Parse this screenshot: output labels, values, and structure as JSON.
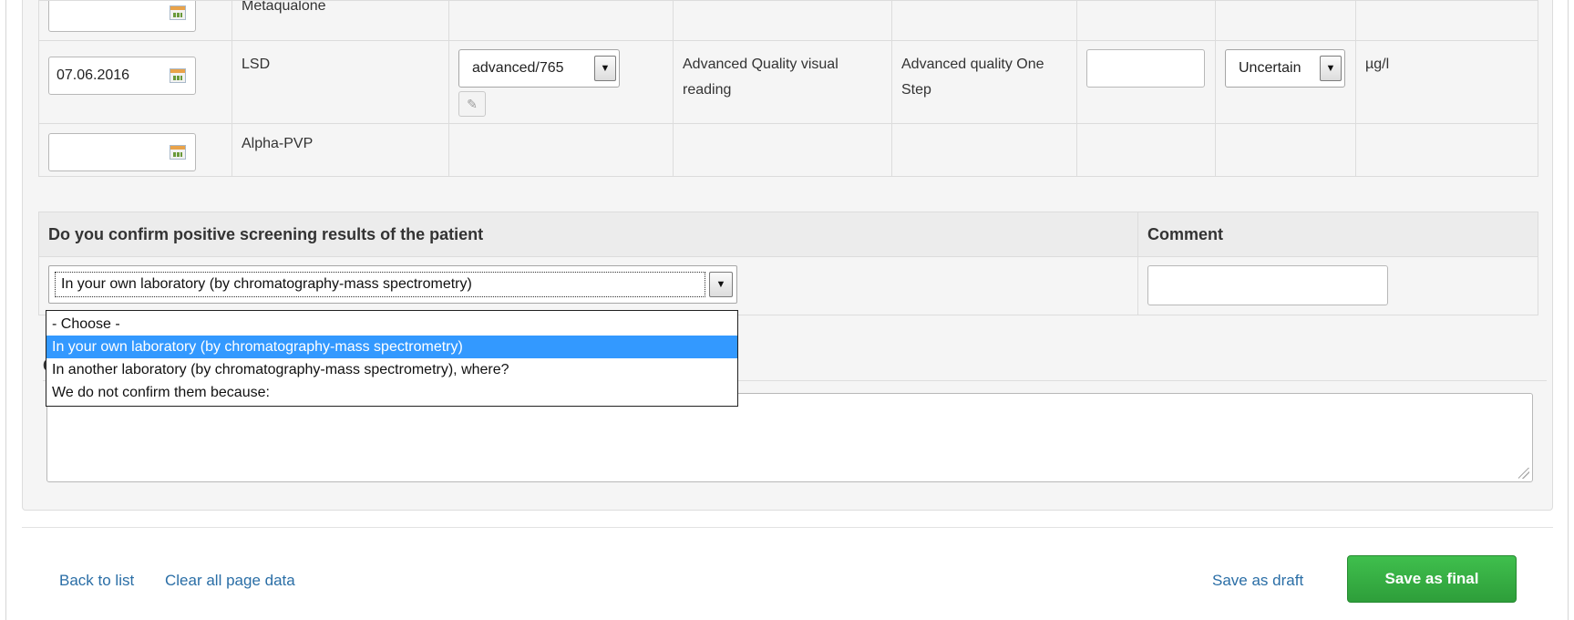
{
  "substances": {
    "rows": [
      {
        "date": "",
        "name": "Metaqualone"
      },
      {
        "date": "07.06.2016",
        "name": "LSD",
        "kit": "advanced/765",
        "method": "Advanced Quality visual reading",
        "analyzer": "Advanced quality One Step",
        "result": "",
        "interpretation": "Uncertain",
        "unit": "µg/l"
      },
      {
        "date": "",
        "name": "Alpha-PVP"
      }
    ]
  },
  "confirmation": {
    "question_header": "Do you confirm positive screening results of the patient",
    "comment_header": "Comment",
    "selected_value": "In your own laboratory (by chromatography-mass spectrometry)",
    "comment_value": "",
    "options": [
      "- Choose -",
      "In your own laboratory (by chromatography-mass spectrometry)",
      "In another laboratory (by chromatography-mass spectrometry), where?",
      "We do not confirm them because:"
    ],
    "selected_index": 1
  },
  "general_comment": {
    "label_visible": "C",
    "value": ""
  },
  "footer": {
    "back_label": "Back to list",
    "clear_label": "Clear all page data",
    "draft_label": "Save as draft",
    "final_label": "Save as final"
  },
  "colors": {
    "link": "#2a6ea6",
    "final_button": "#3aad46",
    "dropdown_highlight": "#3399ff"
  }
}
